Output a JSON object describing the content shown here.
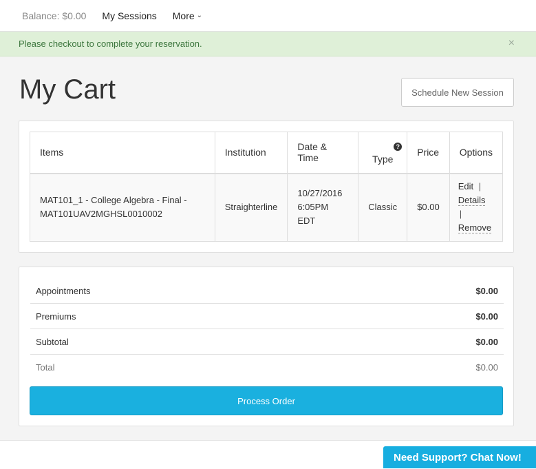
{
  "nav": {
    "balance": "Balance: $0.00",
    "my_sessions": "My Sessions",
    "more": "More"
  },
  "alert": {
    "message": "Please checkout to complete your reservation.",
    "close": "×"
  },
  "page": {
    "title": "My Cart",
    "schedule_button": "Schedule New Session"
  },
  "cart_table": {
    "headers": {
      "items": "Items",
      "institution": "Institution",
      "date_time": "Date & Time",
      "type": "Type",
      "price": "Price",
      "options": "Options"
    },
    "rows": [
      {
        "item_line1": "MAT101_1 - College Algebra - Final -",
        "item_line2": "MAT101UAV2MGHSL0010002",
        "institution": "Straighterline",
        "date": "10/27/2016",
        "time": "6:05PM EDT",
        "type": "Classic",
        "price": "$0.00",
        "options": {
          "edit": "Edit",
          "details": "Details",
          "remove": "Remove",
          "separator": "|"
        }
      }
    ]
  },
  "summary": {
    "appointments_label": "Appointments",
    "appointments_value": "$0.00",
    "premiums_label": "Premiums",
    "premiums_value": "$0.00",
    "subtotal_label": "Subtotal",
    "subtotal_value": "$0.00",
    "total_label": "Total",
    "total_value": "$0.00",
    "process_button": "Process Order"
  },
  "support": {
    "chat_label": "Need Support? Chat Now!"
  },
  "colors": {
    "accent": "#1ab0df",
    "alert_bg": "#dff0d8",
    "alert_text": "#3c763d"
  }
}
